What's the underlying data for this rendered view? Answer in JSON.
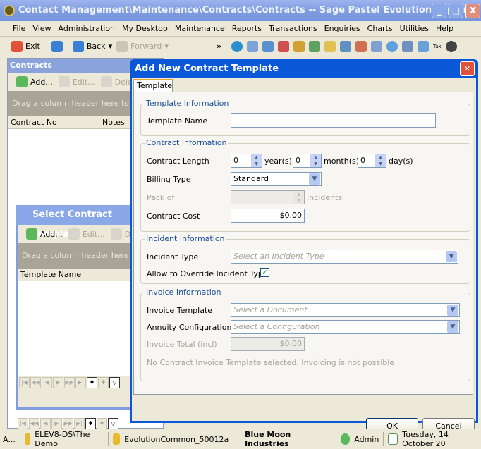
{
  "window": {
    "title": "Contact Management\\Maintenance\\Contracts\\Contracts -- Sage Pastel Evolution Explorer",
    "minimize": "_",
    "maximize": "□",
    "close": "X"
  },
  "menu": [
    "File",
    "View",
    "Administration",
    "My Desktop",
    "Maintenance",
    "Reports",
    "Transactions",
    "Enquiries",
    "Charts",
    "Utilities",
    "Help"
  ],
  "toolbar": {
    "exit": "Exit",
    "back": "Back",
    "forward": "Forward",
    "more": "»",
    "tax": "Tax"
  },
  "contracts": {
    "title": "Contracts",
    "add": "Add...",
    "edit": "Edit...",
    "delete": "Dele",
    "group_hint": "Drag a column header here to group",
    "columns": [
      "Contract No",
      "Notes"
    ]
  },
  "select_window": {
    "title": "Select Contract Template",
    "add": "Add...",
    "edit": "Edit...",
    "delete": "D",
    "group_hint": "Drag a column header here to group",
    "columns": [
      "Template Name"
    ]
  },
  "dialog": {
    "title": "Add New Contract Template",
    "tab": "Template",
    "template_info": {
      "legend": "Template Information",
      "name_label": "Template Name",
      "name_value": ""
    },
    "contract_info": {
      "legend": "Contract Information",
      "length_label": "Contract Length",
      "years": "0",
      "years_unit": "year(s)",
      "months": "0",
      "months_unit": "month(s)",
      "days": "0",
      "days_unit": "day(s)",
      "billing_label": "Billing Type",
      "billing_value": "Standard",
      "pack_label": "Pack of",
      "pack_unit": "Incidents",
      "cost_label": "Contract Cost",
      "cost_value": "$0.00"
    },
    "incident_info": {
      "legend": "Incident Information",
      "type_label": "Incident Type",
      "type_placeholder": "Select an Incident Type",
      "override_label": "Allow to Override Incident Type",
      "override_checked": true
    },
    "invoice_info": {
      "legend": "Invoice Information",
      "template_label": "Invoice Template",
      "template_placeholder": "Select a Document",
      "annuity_label": "Annuity Configuration",
      "annuity_placeholder": "Select a Configuration",
      "total_label": "Invoice Total (incl)",
      "total_value": "$0.00",
      "note": "No Contract Invoice Template selected.  Invoicing is not possible"
    },
    "ok": "OK",
    "cancel": "Cancel"
  },
  "status": {
    "first": "A...",
    "database": "ELEV8-DS\\The Demo",
    "common": "EvolutionCommon_50012a",
    "company": "Blue Moon Industries",
    "user": "Admin",
    "date": "Tuesday, 14 October 20"
  }
}
